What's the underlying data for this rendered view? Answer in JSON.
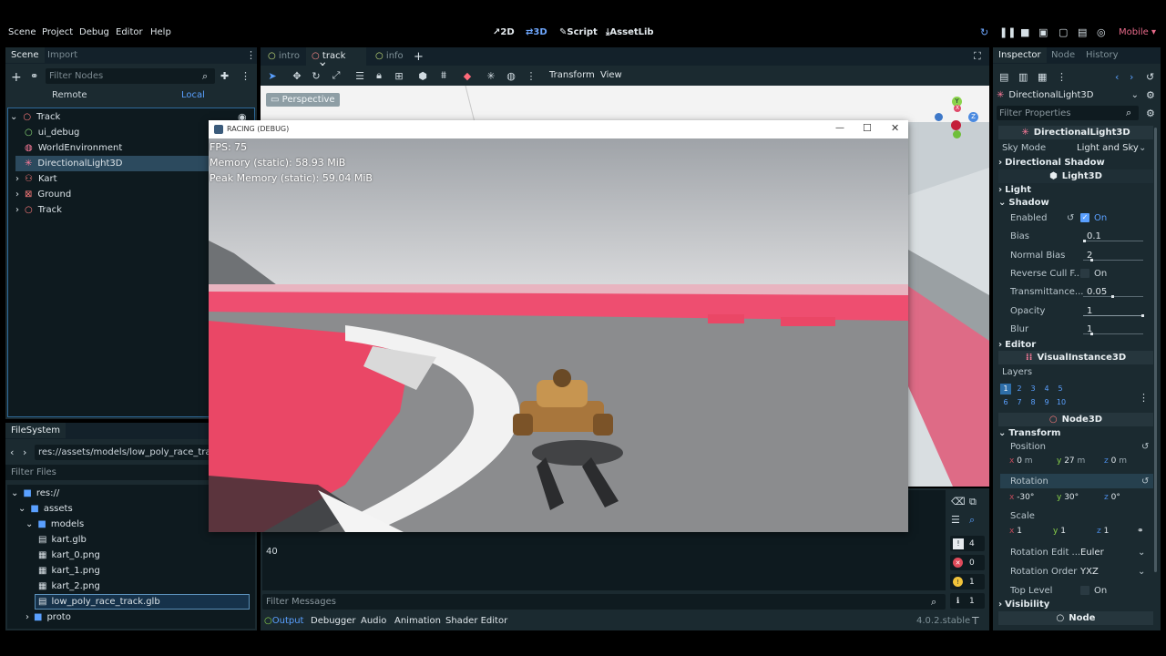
{
  "menu": [
    "Scene",
    "Project",
    "Debug",
    "Editor",
    "Help"
  ],
  "workspaces": [
    {
      "label": "2D",
      "icon": "2d-icon"
    },
    {
      "label": "3D",
      "icon": "3d-icon"
    },
    {
      "label": "Script",
      "icon": "script-icon"
    },
    {
      "label": "AssetLib",
      "icon": "assetlib-icon"
    }
  ],
  "renderer": "Mobile",
  "scene_dock": {
    "tabs": [
      "Scene",
      "Import"
    ],
    "filter_placeholder": "Filter Nodes",
    "remote": "Remote",
    "local": "Local",
    "nodes": [
      {
        "name": "Track",
        "icon": "node3d-icon"
      },
      {
        "name": "ui_debug",
        "icon": "control-icon"
      },
      {
        "name": "WorldEnvironment",
        "icon": "world-environment-icon"
      },
      {
        "name": "DirectionalLight3D",
        "icon": "directional-light-icon"
      },
      {
        "name": "Kart",
        "icon": "kart-icon"
      },
      {
        "name": "Ground",
        "icon": "ground-icon"
      },
      {
        "name": "Track",
        "icon": "node3d-icon"
      }
    ]
  },
  "filesystem": {
    "title": "FileSystem",
    "path": "res://assets/models/low_poly_race_track.glb",
    "filter_placeholder": "Filter Files",
    "items": [
      "res://",
      "assets",
      "models",
      "kart.glb",
      "kart_0.png",
      "kart_1.png",
      "kart_2.png",
      "low_poly_race_track.glb",
      "proto"
    ]
  },
  "scene_tabs": [
    "intro",
    "track",
    "info"
  ],
  "viewport_toolbar": {
    "transform": "Transform",
    "view": "View",
    "perspective": "Perspective"
  },
  "gizmo": {
    "y": "Y",
    "x": "X",
    "z": "Z"
  },
  "game_window": {
    "title": "RACING (DEBUG)",
    "fps": "FPS: 75",
    "memory": "Memory (static): 58.93 MiB",
    "peak": "Peak Memory (static): 59.04 MiB"
  },
  "output": {
    "line": "40",
    "filter_placeholder": "Filter Messages",
    "tabs": [
      "Output",
      "Debugger",
      "Audio",
      "Animation",
      "Shader Editor"
    ],
    "version": "4.0.2.stable",
    "counts": {
      "all": "4",
      "errors": "0",
      "warnings": "1",
      "info": "1"
    }
  },
  "inspector": {
    "tabs": [
      "Inspector",
      "Node",
      "History"
    ],
    "object": "DirectionalLight3D",
    "filter_placeholder": "Filter Properties",
    "class_header": "DirectionalLight3D",
    "sky_mode_label": "Sky Mode",
    "sky_mode_value": "Light and Sky",
    "directional_shadow": "Directional Shadow",
    "light3d": "Light3D",
    "light": "Light",
    "shadow": "Shadow",
    "enabled_label": "Enabled",
    "enabled_value": "On",
    "bias_label": "Bias",
    "bias_value": "0.1",
    "normal_bias_label": "Normal Bias",
    "normal_bias_value": "2",
    "reverse_cull_label": "Reverse Cull F...",
    "reverse_cull_value": "On",
    "transmittance_label": "Transmittance...",
    "transmittance_value": "0.05",
    "opacity_label": "Opacity",
    "opacity_value": "1",
    "blur_label": "Blur",
    "blur_value": "1",
    "editor": "Editor",
    "visual_instance": "VisualInstance3D",
    "layers_label": "Layers",
    "layers": [
      "1",
      "2",
      "3",
      "4",
      "5",
      "6",
      "7",
      "8",
      "9",
      "10"
    ],
    "node3d": "Node3D",
    "transform": "Transform",
    "position_label": "Position",
    "position": {
      "x": "0",
      "y": "27",
      "z": "0",
      "unit": "m"
    },
    "rotation_label": "Rotation",
    "rotation": {
      "x": "-30",
      "y": "30",
      "z": "0"
    },
    "scale_label": "Scale",
    "scale": {
      "x": "1",
      "y": "1",
      "z": "1"
    },
    "rot_edit_label": "Rotation Edit ...",
    "rot_edit_value": "Euler",
    "rot_order_label": "Rotation Order",
    "rot_order_value": "YXZ",
    "top_level_label": "Top Level",
    "top_level_value": "On",
    "visibility": "Visibility",
    "node": "Node"
  },
  "colors": {
    "accent": "#5aa0ff",
    "panel": "#1b2a30",
    "track_red": "#e84a6a",
    "selection": "#2c4a5e"
  }
}
